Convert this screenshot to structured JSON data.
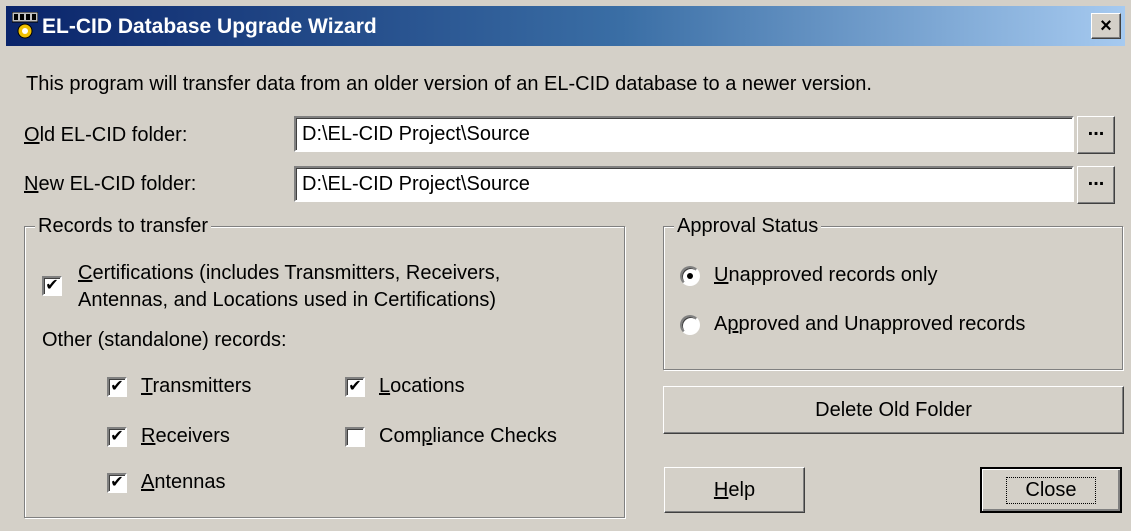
{
  "window": {
    "title": "EL-CID Database Upgrade Wizard",
    "close_glyph": "×"
  },
  "intro": "This program will transfer data from an older version of an EL-CID database to a newer version.",
  "old_folder": {
    "label_accel": "O",
    "label_rest": "ld EL-CID folder:",
    "value": "D:\\EL-CID Project\\Source",
    "browse_label": "..."
  },
  "new_folder": {
    "label_accel": "N",
    "label_rest": "ew EL-CID folder:",
    "value": "D:\\EL-CID Project\\Source",
    "browse_label": "..."
  },
  "records": {
    "legend": "Records to transfer",
    "certifications": {
      "accel": "C",
      "line1_rest": "ertifications (includes Transmitters, Receivers,",
      "line2": "Antennas, and Locations used in Certifications)",
      "checked": true
    },
    "other_label": "Other (standalone) records:",
    "items": [
      {
        "pre": "",
        "accel": "T",
        "post": "ransmitters",
        "checked": true
      },
      {
        "pre": "",
        "accel": "R",
        "post": "eceivers",
        "checked": true
      },
      {
        "pre": "",
        "accel": "A",
        "post": "ntennas",
        "checked": true
      },
      {
        "pre": "",
        "accel": "L",
        "post": "ocations",
        "checked": true
      },
      {
        "pre": "Com",
        "accel": "p",
        "post": "liance Checks",
        "checked": false
      }
    ]
  },
  "approval": {
    "legend": "Approval Status",
    "options": [
      {
        "pre": "",
        "accel": "U",
        "post": "napproved records only",
        "selected": true
      },
      {
        "pre": "A",
        "accel": "p",
        "post": "proved and Unapproved records",
        "selected": false
      }
    ]
  },
  "buttons": {
    "delete_old_folder": "Delete Old Folder",
    "help_accel": "H",
    "help_rest": "elp",
    "close": "Close"
  },
  "icons": {
    "check": "✔",
    "app": "elcid-app-icon"
  }
}
